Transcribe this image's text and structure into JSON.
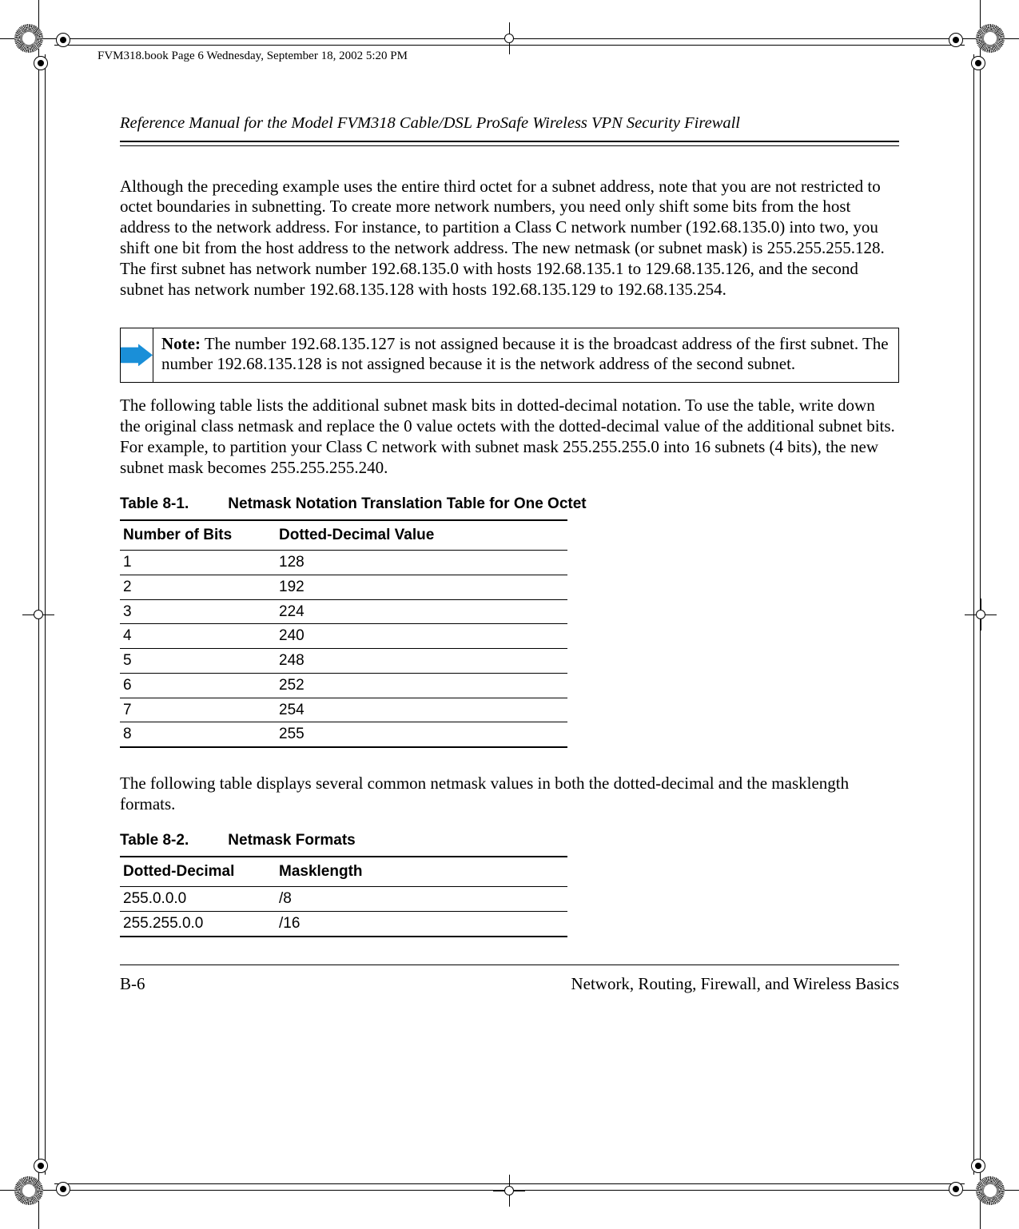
{
  "file_stamp": "FVM318.book  Page 6  Wednesday, September 18, 2002  5:20 PM",
  "running_head": "Reference Manual for the Model FVM318 Cable/DSL ProSafe Wireless VPN Security Firewall",
  "para1": "Although the preceding example uses the entire third octet for a subnet address, note that you are not restricted to octet boundaries in subnetting. To create more network numbers, you need only shift some bits from the host address to the network address. For instance, to partition a Class C network number (192.68.135.0) into two, you shift one bit from the host address to the network address. The new netmask (or subnet mask) is 255.255.255.128. The first subnet has network number 192.68.135.0 with hosts 192.68.135.1 to 129.68.135.126, and the second subnet has network number 192.68.135.128 with hosts 192.68.135.129 to 192.68.135.254.",
  "note": {
    "label": "Note:",
    "text": "The number 192.68.135.127 is not assigned because it is the broadcast address of the first subnet. The number 192.68.135.128 is not assigned because it is the network address of the second subnet."
  },
  "para2": "The following table lists the additional subnet mask bits in dotted-decimal notation. To use the table, write down the original class netmask and replace the 0 value octets with the dotted-decimal value of the additional subnet bits. For example, to partition your Class C network with subnet mask 255.255.255.0 into 16 subnets (4 bits), the new subnet mask becomes 255.255.255.240.",
  "table1": {
    "caption_num": "Table 8-1.",
    "caption_title": "Netmask Notation Translation Table for One Octet",
    "head_c1": "Number of Bits",
    "head_c2": "Dotted-Decimal Value",
    "rows": [
      {
        "c1": "1",
        "c2": "128"
      },
      {
        "c1": "2",
        "c2": "192"
      },
      {
        "c1": "3",
        "c2": "224"
      },
      {
        "c1": "4",
        "c2": "240"
      },
      {
        "c1": "5",
        "c2": "248"
      },
      {
        "c1": "6",
        "c2": "252"
      },
      {
        "c1": "7",
        "c2": "254"
      },
      {
        "c1": "8",
        "c2": "255"
      }
    ]
  },
  "para3": "The following table displays several common netmask values in both the dotted-decimal and the masklength formats.",
  "table2": {
    "caption_num": "Table 8-2.",
    "caption_title": "Netmask Formats",
    "head_c1": "Dotted-Decimal",
    "head_c2": "Masklength",
    "rows": [
      {
        "c1": "255.0.0.0",
        "c2": "/8"
      },
      {
        "c1": "255.255.0.0",
        "c2": "/16"
      }
    ]
  },
  "footer": {
    "left": "B-6",
    "right": "Network, Routing, Firewall, and Wireless Basics"
  }
}
